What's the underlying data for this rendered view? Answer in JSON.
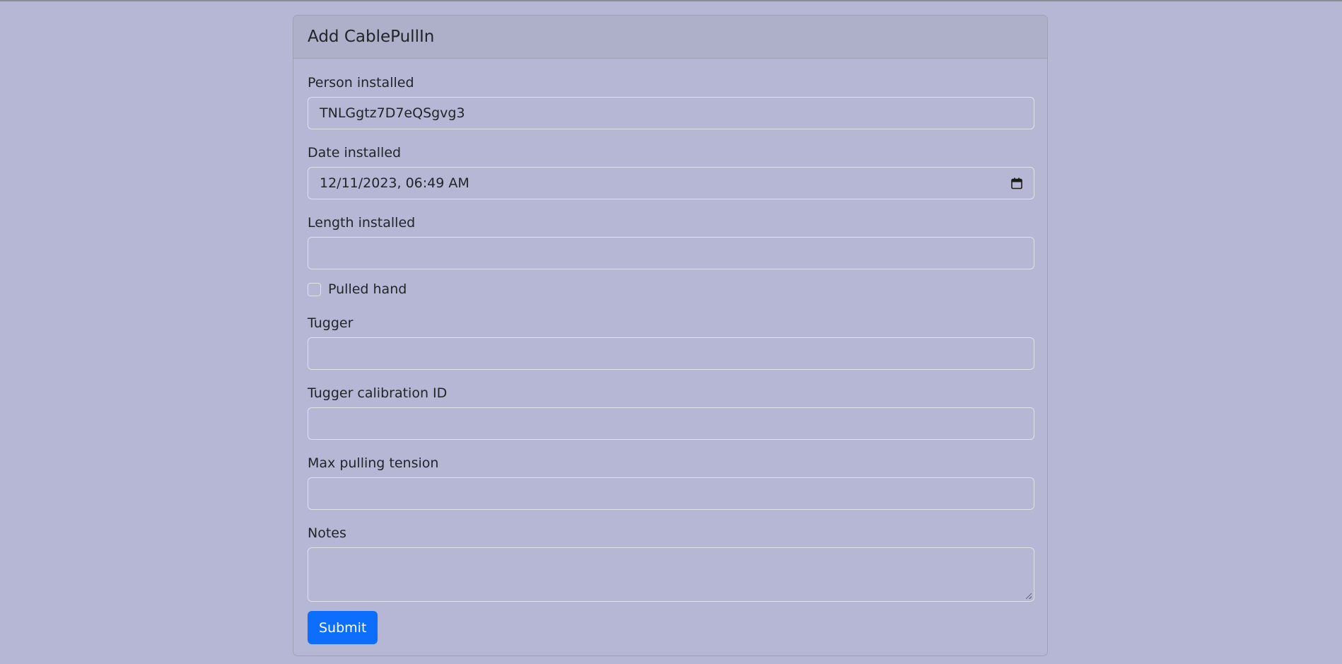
{
  "form": {
    "title": "Add CablePullIn",
    "fields": {
      "person_installed": {
        "label": "Person installed",
        "value": "TNLGgtz7D7eQSgvg3"
      },
      "date_installed": {
        "label": "Date installed",
        "value": "12/11/2023, 06:49 AM",
        "icon": "calendar-icon"
      },
      "length_installed": {
        "label": "Length installed",
        "value": ""
      },
      "pulled_hand": {
        "label": "Pulled hand",
        "checked": false
      },
      "tugger": {
        "label": "Tugger",
        "value": ""
      },
      "tugger_calibration_id": {
        "label": "Tugger calibration ID",
        "value": ""
      },
      "max_pulling_tension": {
        "label": "Max pulling tension",
        "value": ""
      },
      "notes": {
        "label": "Notes",
        "value": ""
      }
    },
    "submit_label": "Submit"
  },
  "colors": {
    "background": "#b6b7d4",
    "header": "#aeafc8",
    "primary": "#0d6efd"
  }
}
